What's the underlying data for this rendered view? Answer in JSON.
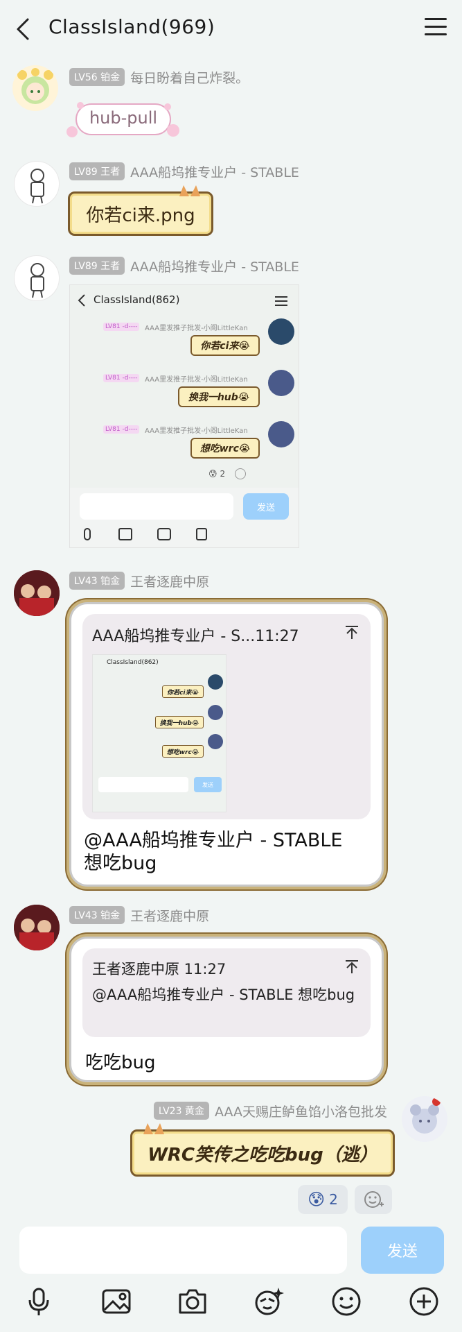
{
  "header": {
    "title": "ClassIsland(969)"
  },
  "messages": [
    {
      "level": "LV56 铂金",
      "nick": "每日盼着自己炸裂。",
      "sticker_text": "hub-pull"
    },
    {
      "level": "LV89 王者",
      "nick": "AAA船坞推专业户 - STABLE",
      "bubble_text": "你若ci来.png"
    },
    {
      "level": "LV89 王者",
      "nick": "AAA船坞推专业户 - STABLE",
      "screenshot": {
        "title": "ClassIsland(862)",
        "rows": [
          {
            "level": "LV81 -d----",
            "nick": "AAA里发推子批发-小阁LittleKan",
            "text": "你若ci来😭"
          },
          {
            "level": "LV81 -d----",
            "nick": "AAA里发推子批发-小阁LittleKan",
            "text": "换我一hub😭"
          },
          {
            "level": "LV81 -d----",
            "nick": "AAA里发推子批发-小阁LittleKan",
            "text": "想吃wrc😭"
          }
        ],
        "reaction_count": "2",
        "send_label": "发送"
      }
    },
    {
      "level": "LV43 铂金",
      "nick": "王者逐鹿中原",
      "quote_header": "AAA船坞推专业户 - S...11:27",
      "reply_text": "@AAA船坞推专业户 - STABLE 想吃bug",
      "mini_screenshot": {
        "title": "ClassIsland(862)",
        "rows": [
          "你若ci来😭",
          "换我一hub😭",
          "想吃wrc😭"
        ],
        "send_label": "发送"
      }
    },
    {
      "level": "LV43 铂金",
      "nick": "王者逐鹿中原",
      "quote_header": "王者逐鹿中原 11:27",
      "quote_text": "@AAA船坞推专业户 - STABLE 想吃bug",
      "reply_text": "吃吃bug"
    },
    {
      "level": "LV23 黄金",
      "nick": "AAA天赐庄鲈鱼馅小洛包批发",
      "bubble_text": "WRC笑传之吃吃bug（逃）",
      "reaction_count": "2"
    }
  ],
  "input": {
    "send_label": "发送"
  },
  "colors": {
    "accent": "#9dd0fb",
    "bubble_fill": "#fbf0c0",
    "bubble_border": "#7a5a2c",
    "badge": "#b5b5b5"
  }
}
